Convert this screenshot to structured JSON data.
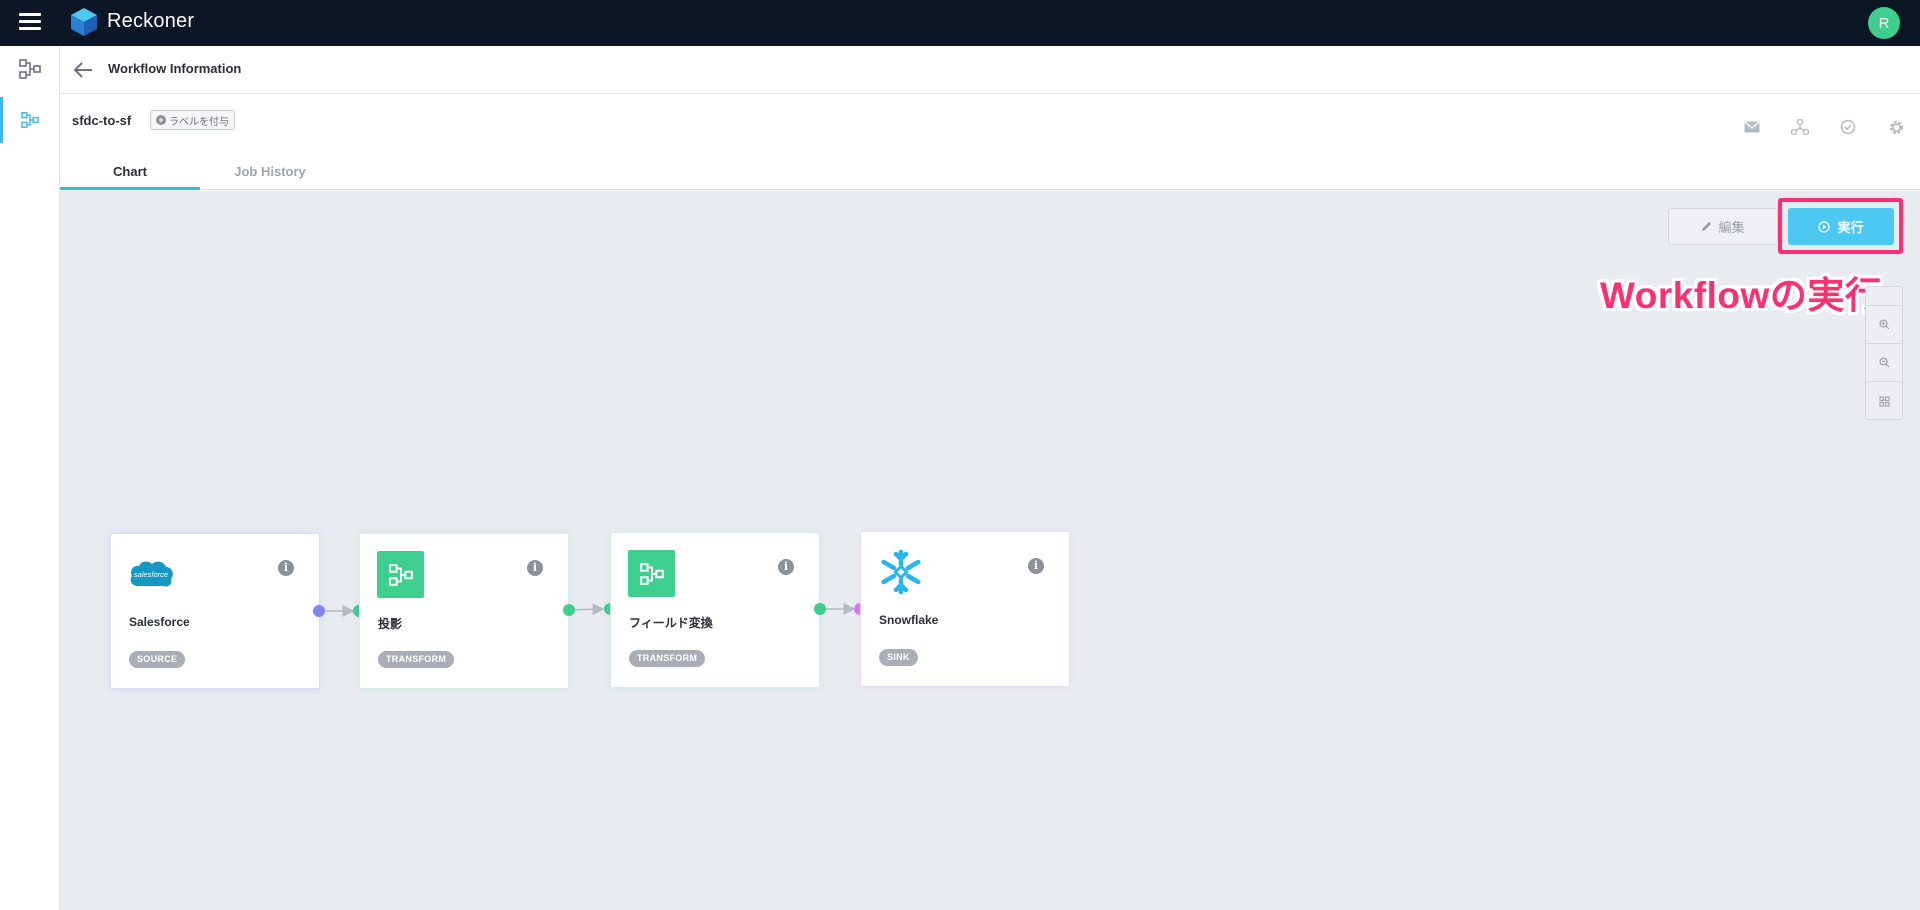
{
  "app": {
    "brand": "Reckoner",
    "user_initial": "R"
  },
  "header": {
    "title": "Workflow Information"
  },
  "workflow": {
    "name": "sfdc-to-sf",
    "label_button": "ラベルを付与"
  },
  "top_icons": [
    "mail-icon",
    "share-network-icon",
    "clock-check-icon",
    "gear-icon"
  ],
  "tabs": [
    {
      "label": "Chart",
      "active": true
    },
    {
      "label": "Job History",
      "active": false
    }
  ],
  "toolbar": {
    "edit_label": "編集",
    "run_label": "実行"
  },
  "annotation": "Workflowの実行",
  "zoom_controls": [
    "zoom-in-icon",
    "zoom-out-icon",
    "fit-view-icon"
  ],
  "nodes": [
    {
      "name": "Salesforce",
      "badge": "SOURCE",
      "logo": "salesforce-logo",
      "logo_text": "salesforce",
      "kind": "source"
    },
    {
      "name": "投影",
      "badge": "TRANSFORM",
      "logo": "transform-icon",
      "kind": "transform"
    },
    {
      "name": "フィールド変換",
      "badge": "TRANSFORM",
      "logo": "transform-icon",
      "kind": "transform"
    },
    {
      "name": "Snowflake",
      "badge": "SINK",
      "logo": "snowflake-logo",
      "kind": "sink"
    }
  ],
  "colors": {
    "topbar": "#0c1624",
    "accent": "#3fb6e8",
    "run_button": "#4cc8f2",
    "annotation": "#ff2f73",
    "transform": "#3ecf8e",
    "source_port": "#7c87f2",
    "sink_port": "#d17ff2",
    "canvas": "#e8ebf0"
  }
}
